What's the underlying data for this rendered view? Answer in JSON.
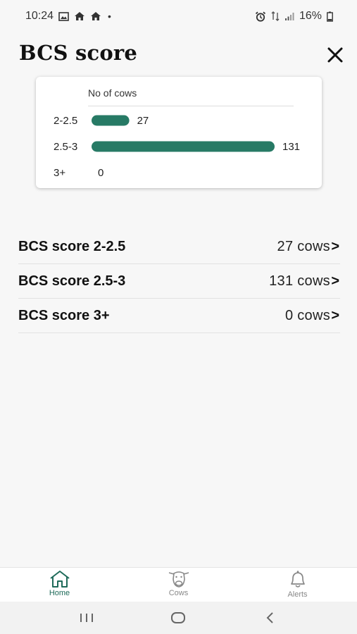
{
  "status_bar": {
    "time": "10:24",
    "battery": "16%",
    "left_icons": [
      "gallery-icon",
      "home-icon",
      "home-icon"
    ],
    "right_icons": [
      "alarm-icon",
      "data-icon",
      "signal-icon",
      "battery-icon"
    ]
  },
  "header": {
    "title": "BCS score",
    "close_icon": "close-icon"
  },
  "chart_data": {
    "type": "bar",
    "orientation": "horizontal",
    "xlabel": "No of cows",
    "categories": [
      "2-2.5",
      "2.5-3",
      "3+"
    ],
    "values": [
      27,
      131,
      0
    ],
    "value_labels": [
      "27",
      "131",
      "0"
    ],
    "bar_color": "#277a65",
    "grid": false
  },
  "list": {
    "rows": [
      {
        "label": "BCS score 2-2.5",
        "count": "27 cows",
        "arrow": ">"
      },
      {
        "label": "BCS score 2.5-3",
        "count": "131 cows",
        "arrow": ">"
      },
      {
        "label": "BCS score 3+",
        "count": "0 cows",
        "arrow": ">"
      }
    ]
  },
  "bottom_nav": {
    "items": [
      {
        "label": "Home",
        "icon": "home-icon",
        "active": true
      },
      {
        "label": "Cows",
        "icon": "cow-icon",
        "active": false
      },
      {
        "label": "Alerts",
        "icon": "bell-icon",
        "active": false
      }
    ]
  },
  "colors": {
    "accent": "#1f6b5a",
    "bar": "#277a65",
    "background": "#f7f7f7"
  }
}
